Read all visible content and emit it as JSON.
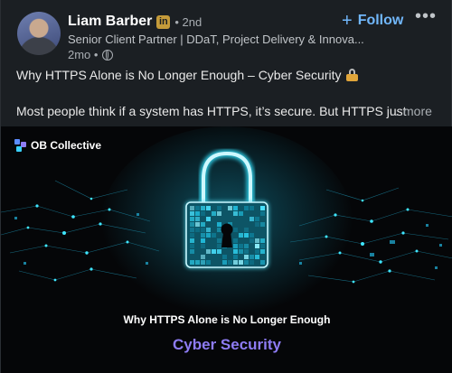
{
  "author": {
    "name": "Liam Barber",
    "badge": "in",
    "degree": "• 2nd",
    "headline": "Senior Client Partner | DDaT, Project Delivery & Innova...",
    "time": "2mo •",
    "visibility_icon": "globe-icon"
  },
  "actions": {
    "follow_plus": "+",
    "follow_label": "Follow",
    "more_label": "•••"
  },
  "post": {
    "title": "Why HTTPS Alone is No Longer Enough – Cyber Security",
    "title_icon": "lock-key-emoji",
    "body": "Most people think if a system has HTTPS, it’s secure. But HTTPS just",
    "see_more": "…more"
  },
  "image": {
    "brand": "OB Collective",
    "headline": "Why HTTPS Alone is No Longer Enough",
    "subtitle": "Cyber Security"
  },
  "colors": {
    "background": "#1b1f23",
    "follow": "#71b7fb",
    "lock_glow": "#2fe0ff",
    "subtitle": "#8e7cf4"
  }
}
